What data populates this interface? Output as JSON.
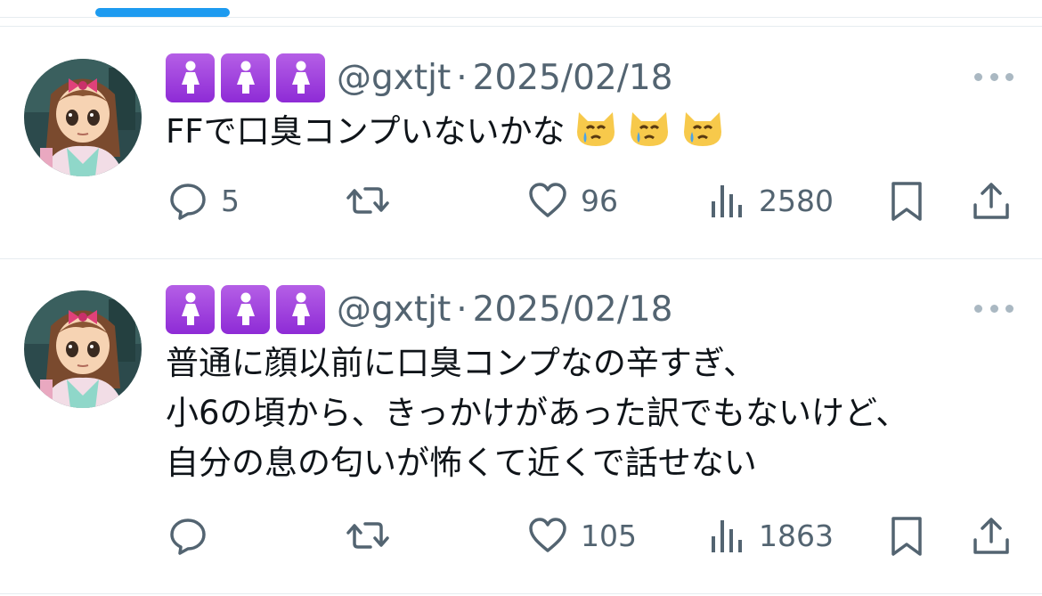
{
  "nav": {
    "active_tab_color": "#1d9bf0"
  },
  "tweets": [
    {
      "name_emojis": [
        "woman-icon",
        "woman-icon",
        "woman-icon"
      ],
      "handle": "@gxtjt",
      "separator": "·",
      "date": "2025/02/18",
      "text_lines": [
        "FFで口臭コンプいないかな"
      ],
      "trailing_emojis": [
        "crying-cat-face-icon",
        "crying-cat-face-icon",
        "crying-cat-face-icon"
      ],
      "stats": {
        "replies": "5",
        "retweets": "",
        "likes": "96",
        "views": "2580"
      }
    },
    {
      "name_emojis": [
        "woman-icon",
        "woman-icon",
        "woman-icon"
      ],
      "handle": "@gxtjt",
      "separator": "·",
      "date": "2025/02/18",
      "text_lines": [
        "普通に顔以前に口臭コンプなの辛すぎ、",
        "小6の頃から、きっかけがあった訳でもないけど、",
        "自分の息の匂いが怖くて近くで話せない"
      ],
      "trailing_emojis": [],
      "stats": {
        "replies": "",
        "retweets": "",
        "likes": "105",
        "views": "1863"
      }
    }
  ],
  "colors": {
    "badge": "#9b3fe0",
    "secondary_text": "#536471",
    "divider": "#e6ecf0"
  }
}
